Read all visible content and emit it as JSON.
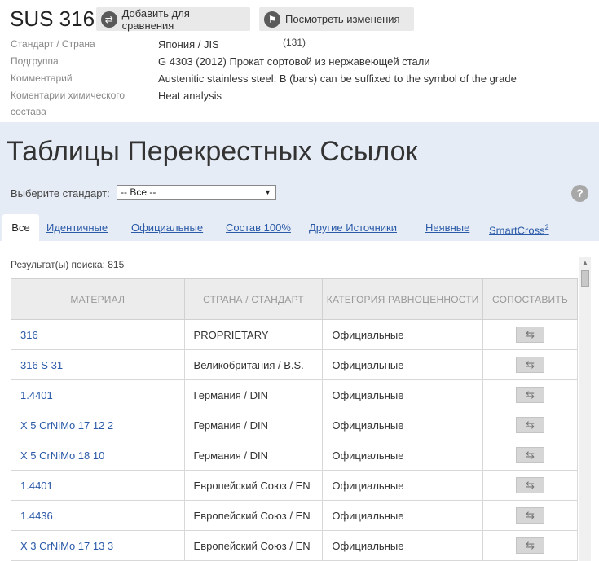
{
  "header": {
    "title": "SUS 316",
    "compare_button": "Добавить для сравнения",
    "changes_button": "Посмотреть изменения"
  },
  "info": {
    "standard_label": "Стандарт / Страна",
    "standard_value": "Япония / JIS",
    "standard_count": "(131)",
    "subgroup_label": "Подгруппа",
    "subgroup_value": "G 4303 (2012) Прокат сортовой из нержавеющей стали",
    "comment_label": "Комментарий",
    "comment_value": "Austenitic stainless steel; B (bars) can be suffixed to the symbol of the grade",
    "chem_label_1": "Коментарии химического",
    "chem_label_2": "состава",
    "chem_value": "Heat analysis"
  },
  "cross": {
    "title": "Таблицы Перекрестных Ссылок",
    "select_label": "Выберите стандарт:",
    "select_value": "-- Все --",
    "help": "?"
  },
  "tabs": [
    "Все",
    "Идентичные",
    "Официальные",
    "Состав 100%",
    "Другие Источники",
    "Неявные",
    "SmartCross"
  ],
  "smartcross_sup": "2",
  "results_text": "Результат(ы) поиска: 815",
  "table": {
    "headers": [
      "МАТЕРИАЛ",
      "СТРАНА / СТАНДАРТ",
      "КАТЕГОРИЯ РАВНОЦЕННОСТИ",
      "СОПОСТАВИТЬ"
    ],
    "rows": [
      {
        "material": "316",
        "standard": "PROPRIETARY",
        "category": "Официальные"
      },
      {
        "material": "316 S 31",
        "standard": "Великобритания / B.S.",
        "category": "Официальные"
      },
      {
        "material": "1.4401",
        "standard": "Германия / DIN",
        "category": "Официальные"
      },
      {
        "material": "X 5 CrNiMo 17 12 2",
        "standard": "Германия / DIN",
        "category": "Официальные"
      },
      {
        "material": "X 5 CrNiMo 18 10",
        "standard": "Германия / DIN",
        "category": "Официальные"
      },
      {
        "material": "1.4401",
        "standard": "Европейский Союз / EN",
        "category": "Официальные"
      },
      {
        "material": "1.4436",
        "standard": "Европейский Союз / EN",
        "category": "Официальные"
      },
      {
        "material": "X 3 CrNiMo 17 13 3",
        "standard": "Европейский Союз / EN",
        "category": "Официальные"
      }
    ]
  },
  "icons": {
    "compare": "compare-icon",
    "flag": "flag-icon",
    "arrows": "left-right-arrows-icon"
  }
}
